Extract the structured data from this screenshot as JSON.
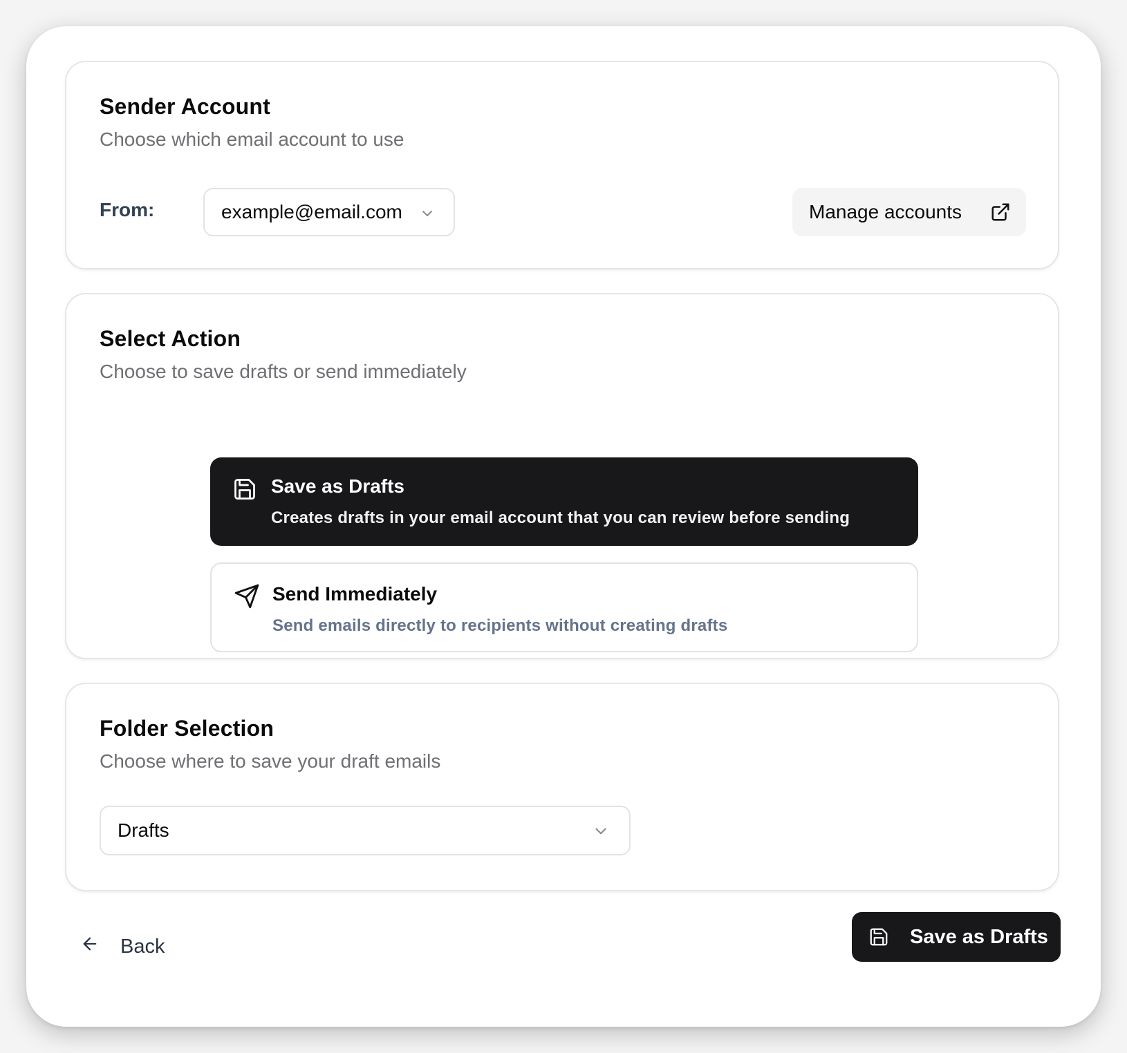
{
  "sender": {
    "title": "Sender Account",
    "subtitle": "Choose which email account to use",
    "from_label": "From:",
    "from_value": "example@email.com",
    "manage_label": "Manage accounts"
  },
  "action": {
    "title": "Select Action",
    "subtitle": "Choose to save drafts or send immediately",
    "options": [
      {
        "title": "Save as Drafts",
        "description": "Creates drafts in your email account that you can review before sending",
        "selected": true,
        "icon": "save-icon"
      },
      {
        "title": "Send Immediately",
        "description": "Send emails directly to recipients without creating drafts",
        "selected": false,
        "icon": "send-icon"
      }
    ]
  },
  "folder": {
    "title": "Folder Selection",
    "subtitle": "Choose where to save your draft emails",
    "selected": "Drafts"
  },
  "footer": {
    "back_label": "Back",
    "primary_label": "Save as Drafts"
  },
  "colors": {
    "primary": "#18181a",
    "muted_text": "#6f6f74",
    "border": "#e3e3e6"
  }
}
